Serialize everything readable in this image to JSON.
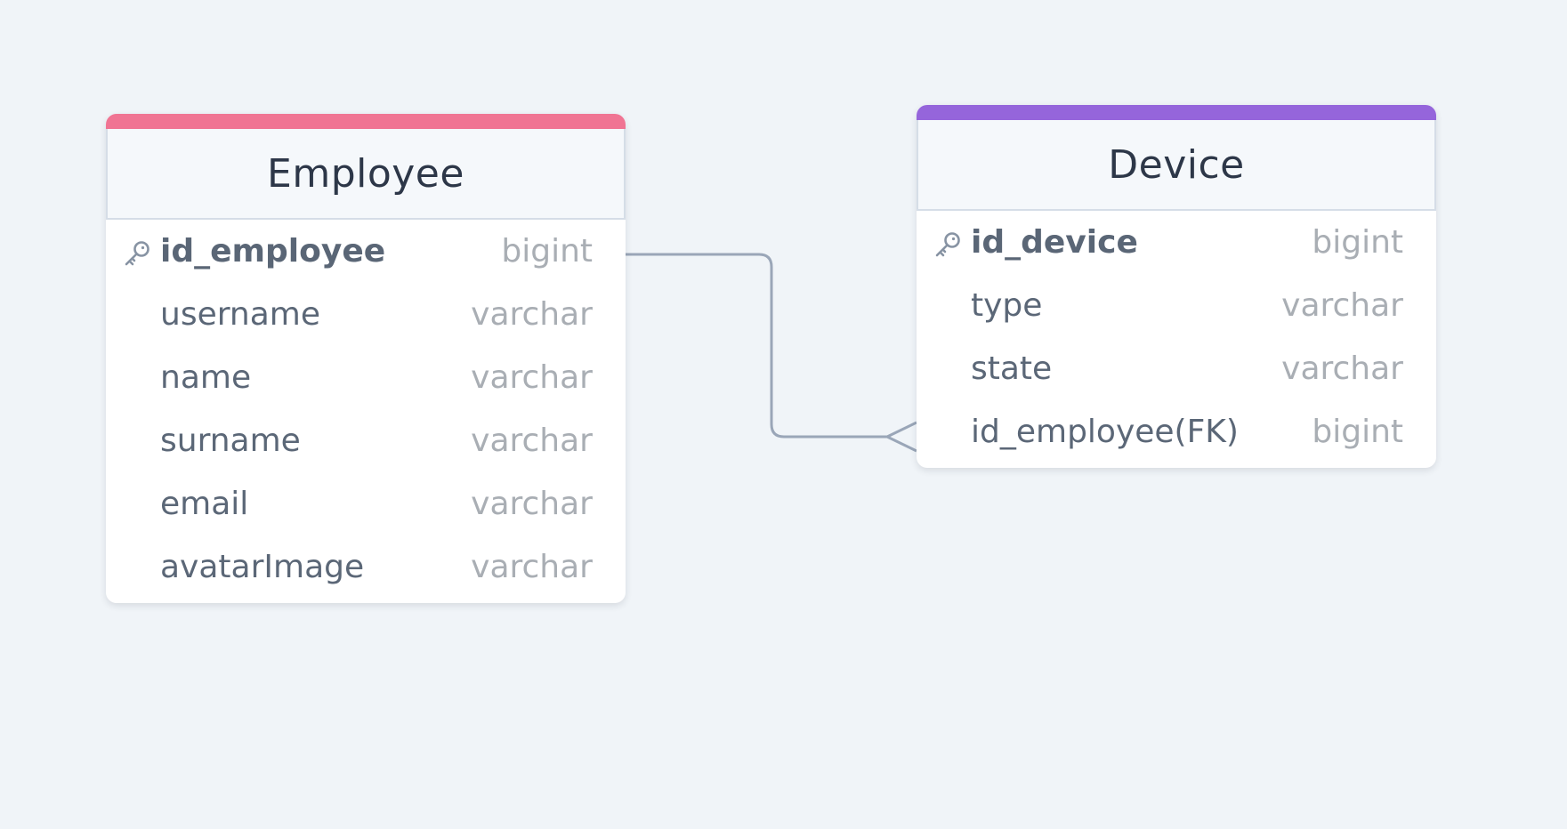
{
  "colors": {
    "background": "#f0f4f8",
    "employee_accent": "#f07493",
    "device_accent": "#9565db",
    "connector": "#9aa6b8"
  },
  "tables": {
    "employee": {
      "title": "Employee",
      "columns": [
        {
          "name": "id_employee",
          "type": "bigint",
          "primary_key": true,
          "icon": "key-icon"
        },
        {
          "name": "username",
          "type": "varchar",
          "primary_key": false
        },
        {
          "name": "name",
          "type": "varchar",
          "primary_key": false
        },
        {
          "name": "surname",
          "type": "varchar",
          "primary_key": false
        },
        {
          "name": "email",
          "type": "varchar",
          "primary_key": false
        },
        {
          "name": "avatarImage",
          "type": "varchar",
          "primary_key": false
        }
      ]
    },
    "device": {
      "title": "Device",
      "columns": [
        {
          "name": "id_device",
          "type": "bigint",
          "primary_key": true,
          "icon": "key-icon"
        },
        {
          "name": "type",
          "type": "varchar",
          "primary_key": false
        },
        {
          "name": "state",
          "type": "varchar",
          "primary_key": false
        },
        {
          "name": "id_employee(FK)",
          "type": "bigint",
          "primary_key": false
        }
      ]
    }
  },
  "relationships": [
    {
      "from": "Employee.id_employee",
      "to": "Device.id_employee(FK)",
      "from_cardinality": "one",
      "to_cardinality": "many"
    }
  ]
}
